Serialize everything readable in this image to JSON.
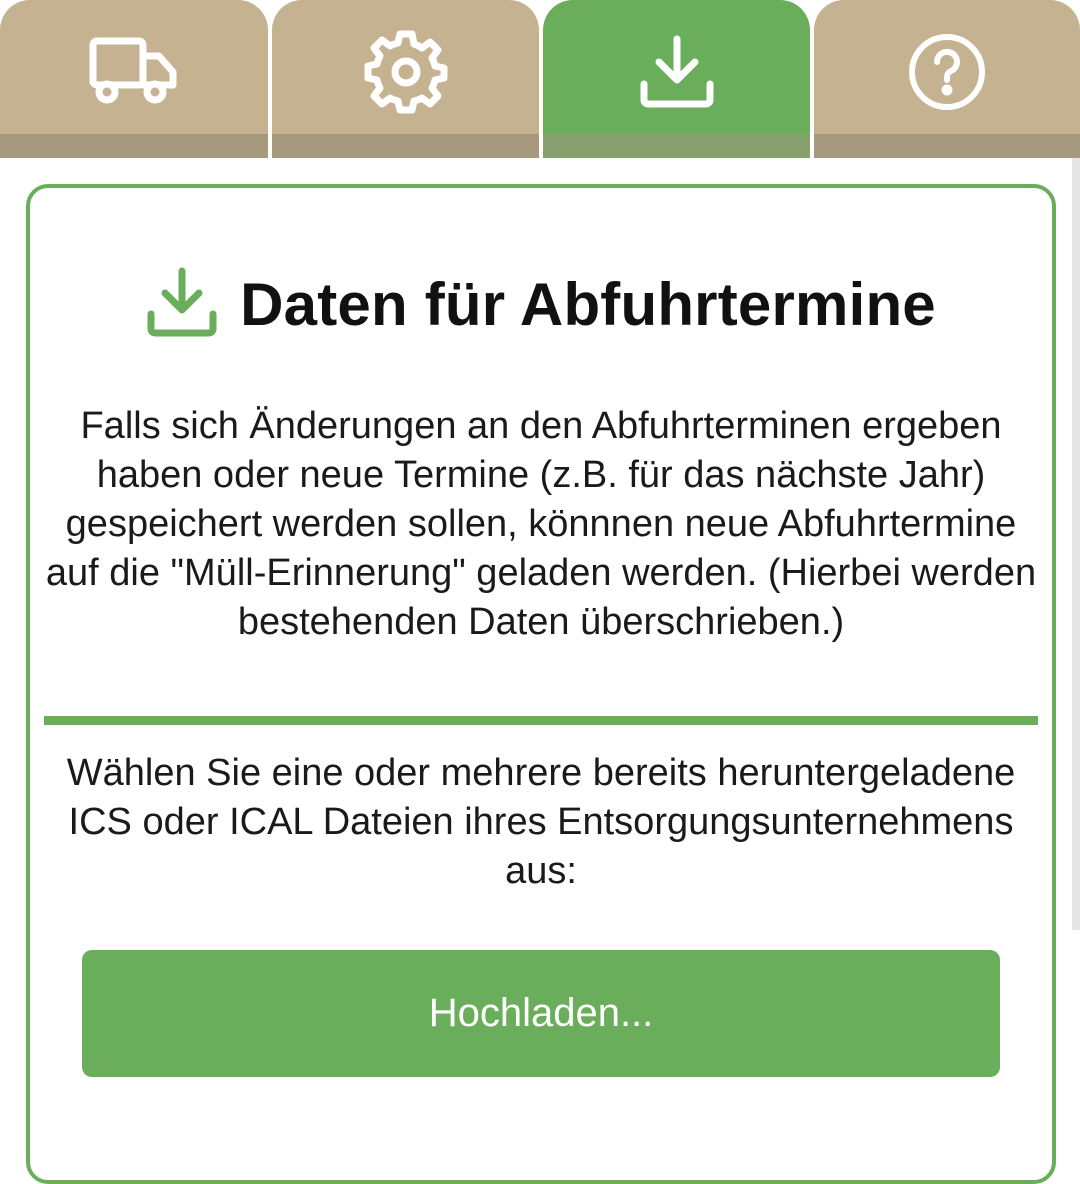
{
  "tabs": [
    {
      "icon": "truck-icon",
      "active": false
    },
    {
      "icon": "gear-icon",
      "active": false
    },
    {
      "icon": "download-icon",
      "active": true
    },
    {
      "icon": "help-icon",
      "active": false
    }
  ],
  "card": {
    "title": "Daten für Abfuhrtermine",
    "title_icon": "download-icon",
    "intro": "Falls sich Änderungen an den Abfuhrterminen ergeben haben oder neue Termine (z.B. für das nächste Jahr) gespeichert werden sollen, könnnen neue Abfuhrtermine auf die \"Müll-Erinnerung\" geladen werden. (Hierbei werden bestehenden Daten überschrieben.)",
    "instruction": "Wählen Sie eine oder mehrere bereits heruntergeladene ICS oder ICAL Dateien ihres Entsorgungsunternehmens aus:",
    "upload_label": "Hochladen..."
  },
  "colors": {
    "accent": "#6aae5c",
    "tab_inactive": "#c4b290",
    "tab_shadow": "#a7997e"
  }
}
